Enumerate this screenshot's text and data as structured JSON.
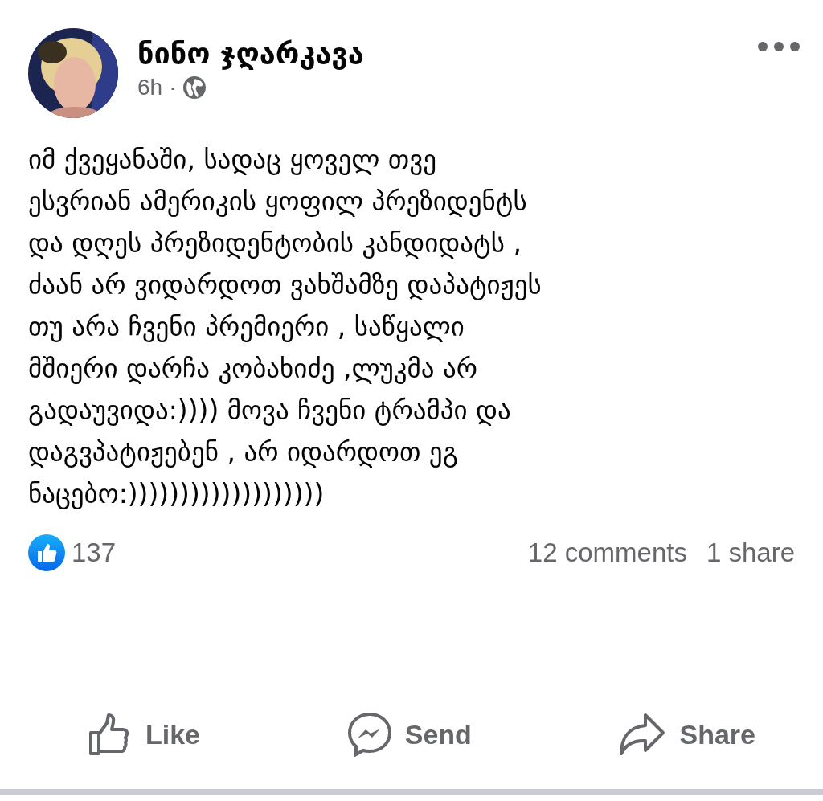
{
  "post": {
    "author": "ნინო ჯღარკავა",
    "time": "6h",
    "separator": "·",
    "text": "იმ ქვეყანაში, სადაც ყოველ თვე\nესვრიან  ამერიკის ყოფილ პრეზიდენტს\nდა დღეს პრეზიდენტობის კანდიდატს ,\nძაან არ ვიდარდოთ ვახშამზე დაპატიჟეს\nთუ არა ჩვენი პრემიერი , საწყალი\nმშიერი დარჩა კობახიძე ,ლუკმა არ\nგადაუვიდა:)))) მოვა ჩვენი ტრამპი და\nდაგვპატიჟებენ , არ იდარდოთ ეგ\nნაცებო:)))))))))))))))))))"
  },
  "stats": {
    "reactions": "137",
    "comments": "12 comments",
    "shares": "1 share"
  },
  "actions": [
    {
      "kind": "like",
      "label": "Like"
    },
    {
      "kind": "send",
      "label": "Send"
    },
    {
      "kind": "share",
      "label": "Share"
    }
  ]
}
